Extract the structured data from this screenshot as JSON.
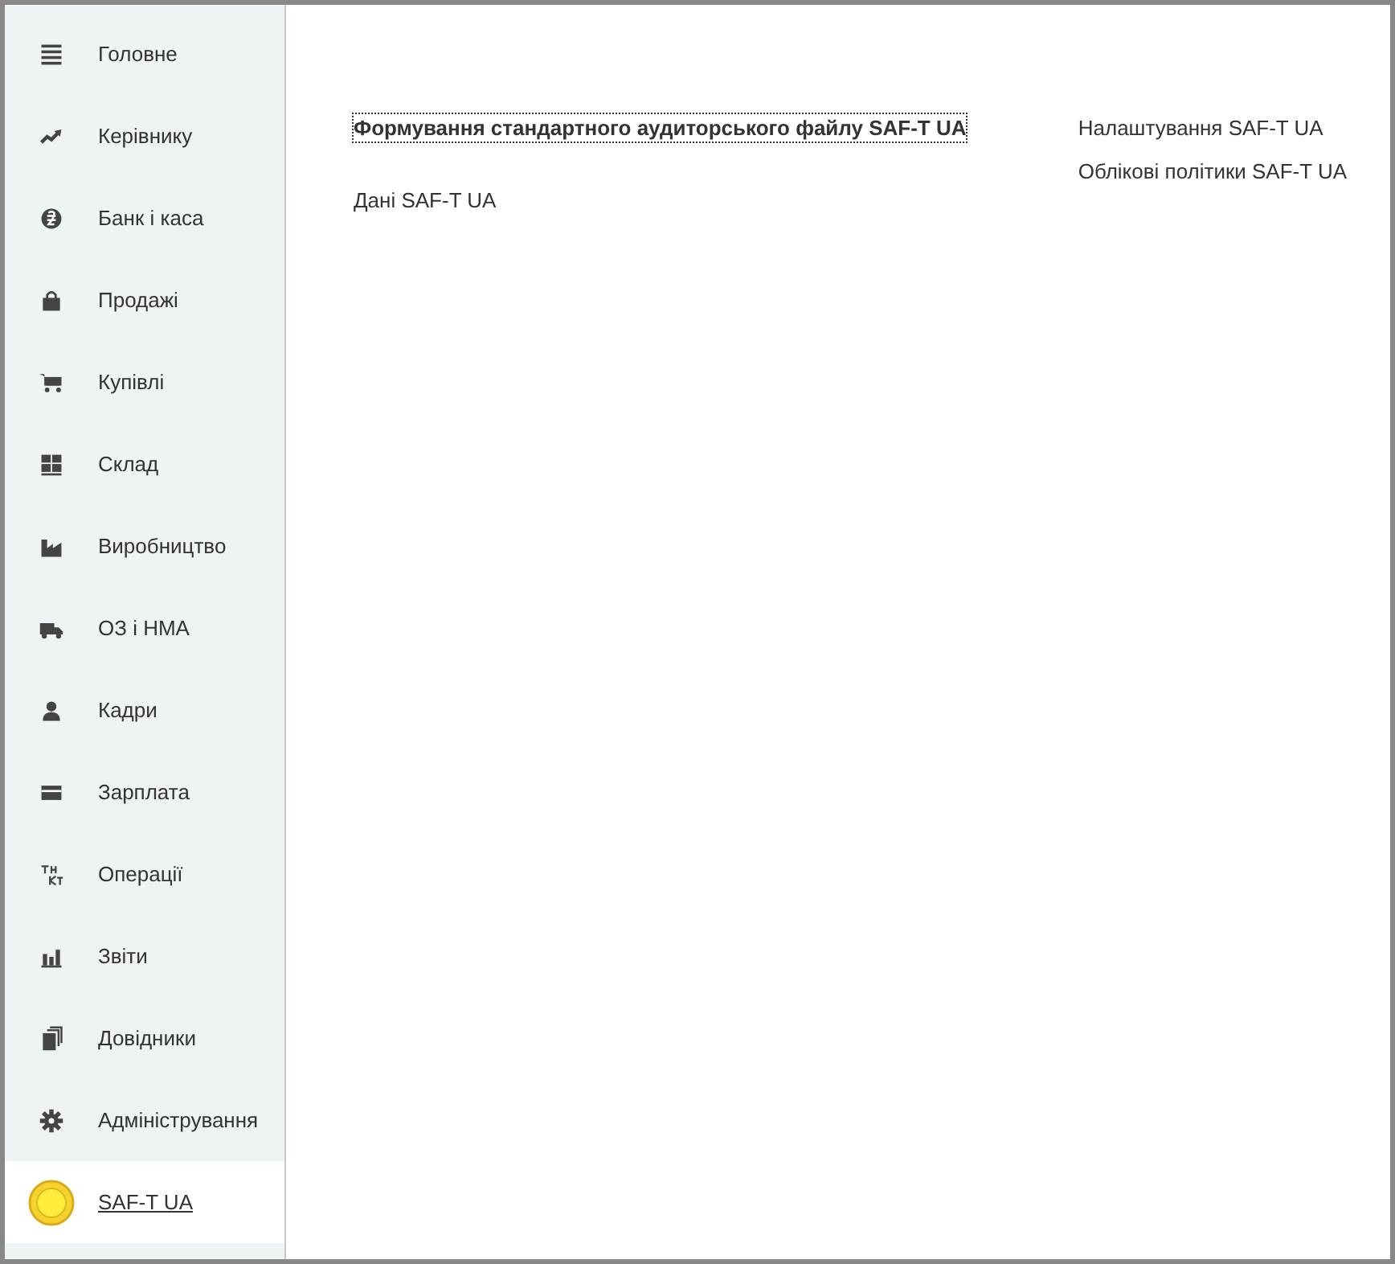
{
  "sidebar": {
    "items": [
      {
        "label": "Головне",
        "selected": false
      },
      {
        "label": "Керівнику",
        "selected": false
      },
      {
        "label": "Банк і каса",
        "selected": false
      },
      {
        "label": "Продажі",
        "selected": false
      },
      {
        "label": "Купівлі",
        "selected": false
      },
      {
        "label": "Склад",
        "selected": false
      },
      {
        "label": "Виробництво",
        "selected": false
      },
      {
        "label": "ОЗ і НМА",
        "selected": false
      },
      {
        "label": "Кадри",
        "selected": false
      },
      {
        "label": "Зарплата",
        "selected": false
      },
      {
        "label": "Операції",
        "selected": false
      },
      {
        "label": "Звіти",
        "selected": false
      },
      {
        "label": "Довідники",
        "selected": false
      },
      {
        "label": "Адміністрування",
        "selected": false
      },
      {
        "label": "SAF-T UA",
        "selected": true
      }
    ]
  },
  "main": {
    "left_links": [
      {
        "text": "Формування стандартного аудиторського файлу SAF-T UA",
        "important": true,
        "focused": true
      },
      {
        "text": "Дані SAF-T UA",
        "important": false,
        "focused": false
      }
    ],
    "right_links": [
      {
        "text": "Налаштування SAF-T UA"
      },
      {
        "text": "Облікові політики SAF-T UA"
      }
    ]
  }
}
